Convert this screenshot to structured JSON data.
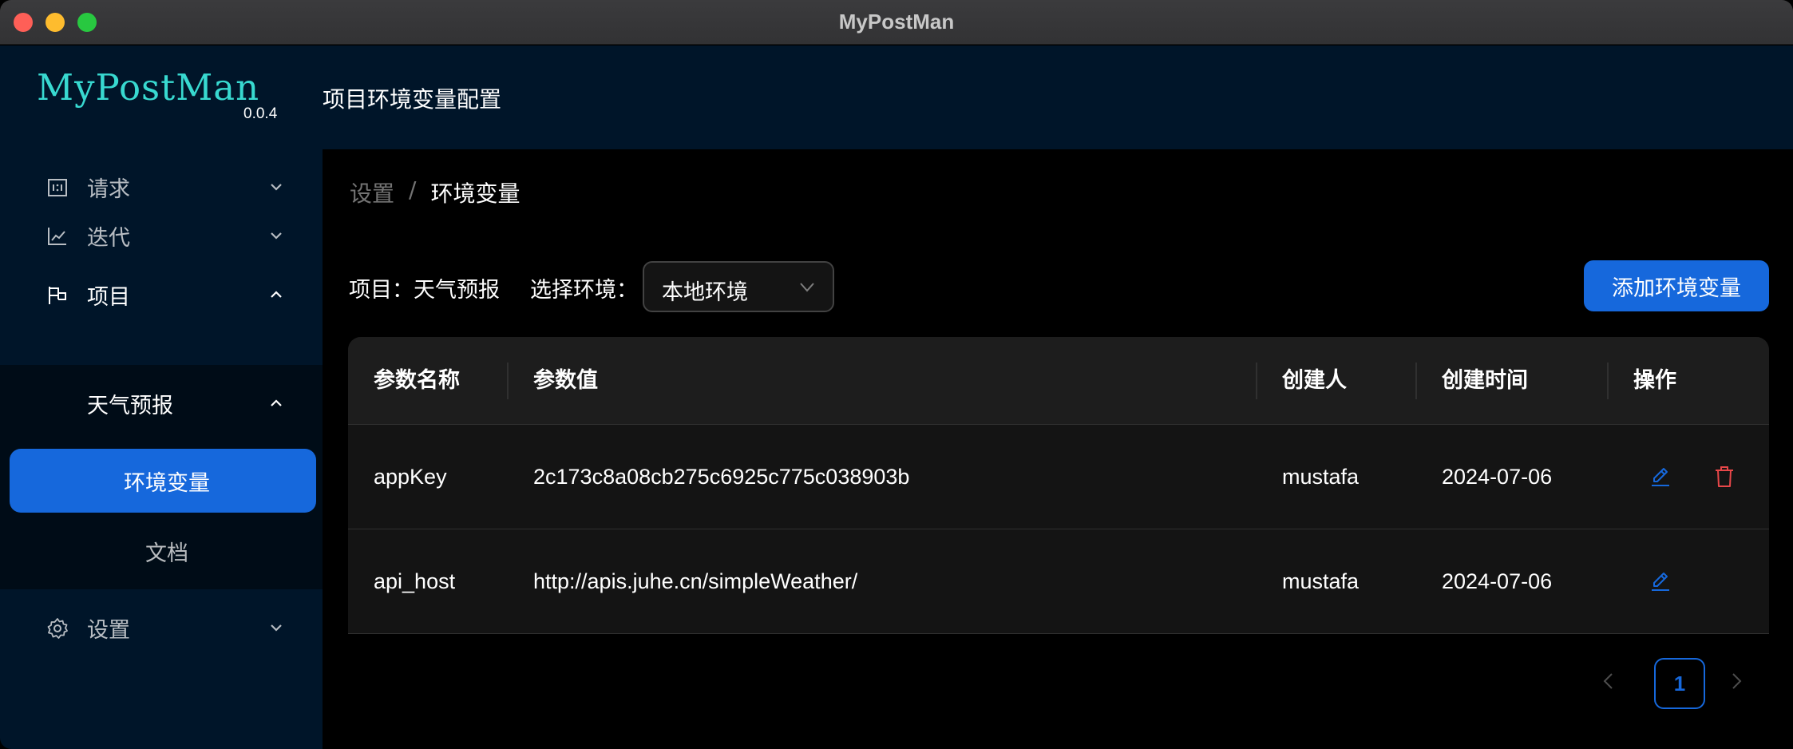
{
  "window": {
    "title": "MyPostMan"
  },
  "sidebar": {
    "logo": "MyPostMan",
    "version": "0.0.4",
    "menu": [
      {
        "label": "请求",
        "icon": "request-icon"
      },
      {
        "label": "迭代",
        "icon": "chart-line-icon"
      },
      {
        "label": "项目",
        "icon": "flag-icon"
      },
      {
        "label": "设置",
        "icon": "gear-icon"
      }
    ],
    "project_group": "天气预报",
    "project_items": [
      {
        "label": "环境变量",
        "selected": true
      },
      {
        "label": "文档",
        "selected": false
      }
    ]
  },
  "header": {
    "title": "项目环境变量配置"
  },
  "breadcrumb": {
    "parent": "设置",
    "separator": "/",
    "current": "环境变量"
  },
  "toolbar": {
    "project_label": "项目：天气预报",
    "env_label": "选择环境：",
    "env_selected": "本地环境",
    "add_button": "添加环境变量"
  },
  "table": {
    "columns": [
      "参数名称",
      "参数值",
      "创建人",
      "创建时间",
      "操作"
    ],
    "rows": [
      {
        "name": "appKey",
        "value": "2c173c8a08cb275c6925c775c038903b",
        "creator": "mustafa",
        "created": "2024-07-06",
        "deletable": true
      },
      {
        "name": "api_host",
        "value": "http://apis.juhe.cn/simpleWeather/",
        "creator": "mustafa",
        "created": "2024-07-06",
        "deletable": false
      }
    ]
  },
  "pagination": {
    "current_page": "1"
  },
  "colors": {
    "primary": "#1668dc",
    "danger": "#e84749",
    "logo": "#38d9d0",
    "sidebar": "#001529"
  }
}
